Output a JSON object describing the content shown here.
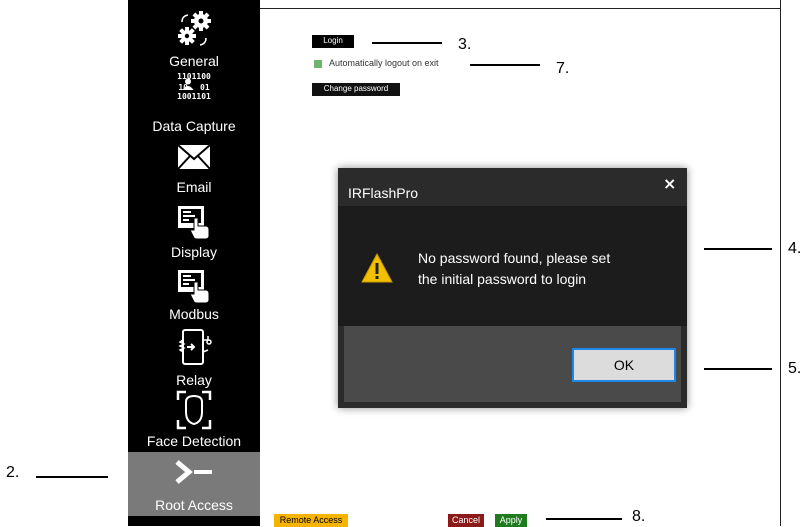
{
  "sidebar": {
    "items": [
      {
        "label": "General",
        "icon": "gears-icon"
      },
      {
        "label": "Data Capture",
        "icon": "data-capture-icon",
        "binary_lines": [
          "1101100",
          "10",
          "01",
          "1001101"
        ]
      },
      {
        "label": "Email",
        "icon": "envelope-icon"
      },
      {
        "label": "Display",
        "icon": "display-touch-icon"
      },
      {
        "label": "Modbus",
        "icon": "modbus-touch-icon"
      },
      {
        "label": "Relay",
        "icon": "relay-icon"
      },
      {
        "label": "Face Detection",
        "icon": "face-detection-icon"
      },
      {
        "label": "Root Access",
        "icon": "terminal-icon",
        "selected": true
      }
    ]
  },
  "main": {
    "login_label": "Login",
    "auto_logout_label": "Automatically logout on exit",
    "change_password_label": "Change password",
    "remote_access_label": "Remote Access",
    "cancel_label": "Cancel",
    "apply_label": "Apply"
  },
  "dialog": {
    "title": "IRFlashPro",
    "close_symbol": "×",
    "message_line1": "No password found, please set",
    "message_line2": "the initial password to login",
    "ok_label": "OK",
    "icon": "warning-icon"
  },
  "callouts": {
    "c2": "2.",
    "c3": "3.",
    "c4": "4.",
    "c5": "5.",
    "c7": "7.",
    "c8": "8."
  },
  "colors": {
    "sidebar_bg": "#000000",
    "selected_bg": "#7a7a7a",
    "checkbox": "#6fb36f",
    "remote_access": "#f5b400",
    "cancel": "#8b1a1a",
    "apply": "#1e7b1e",
    "ok_border": "#1d88e5",
    "warning": "#f3c000"
  }
}
